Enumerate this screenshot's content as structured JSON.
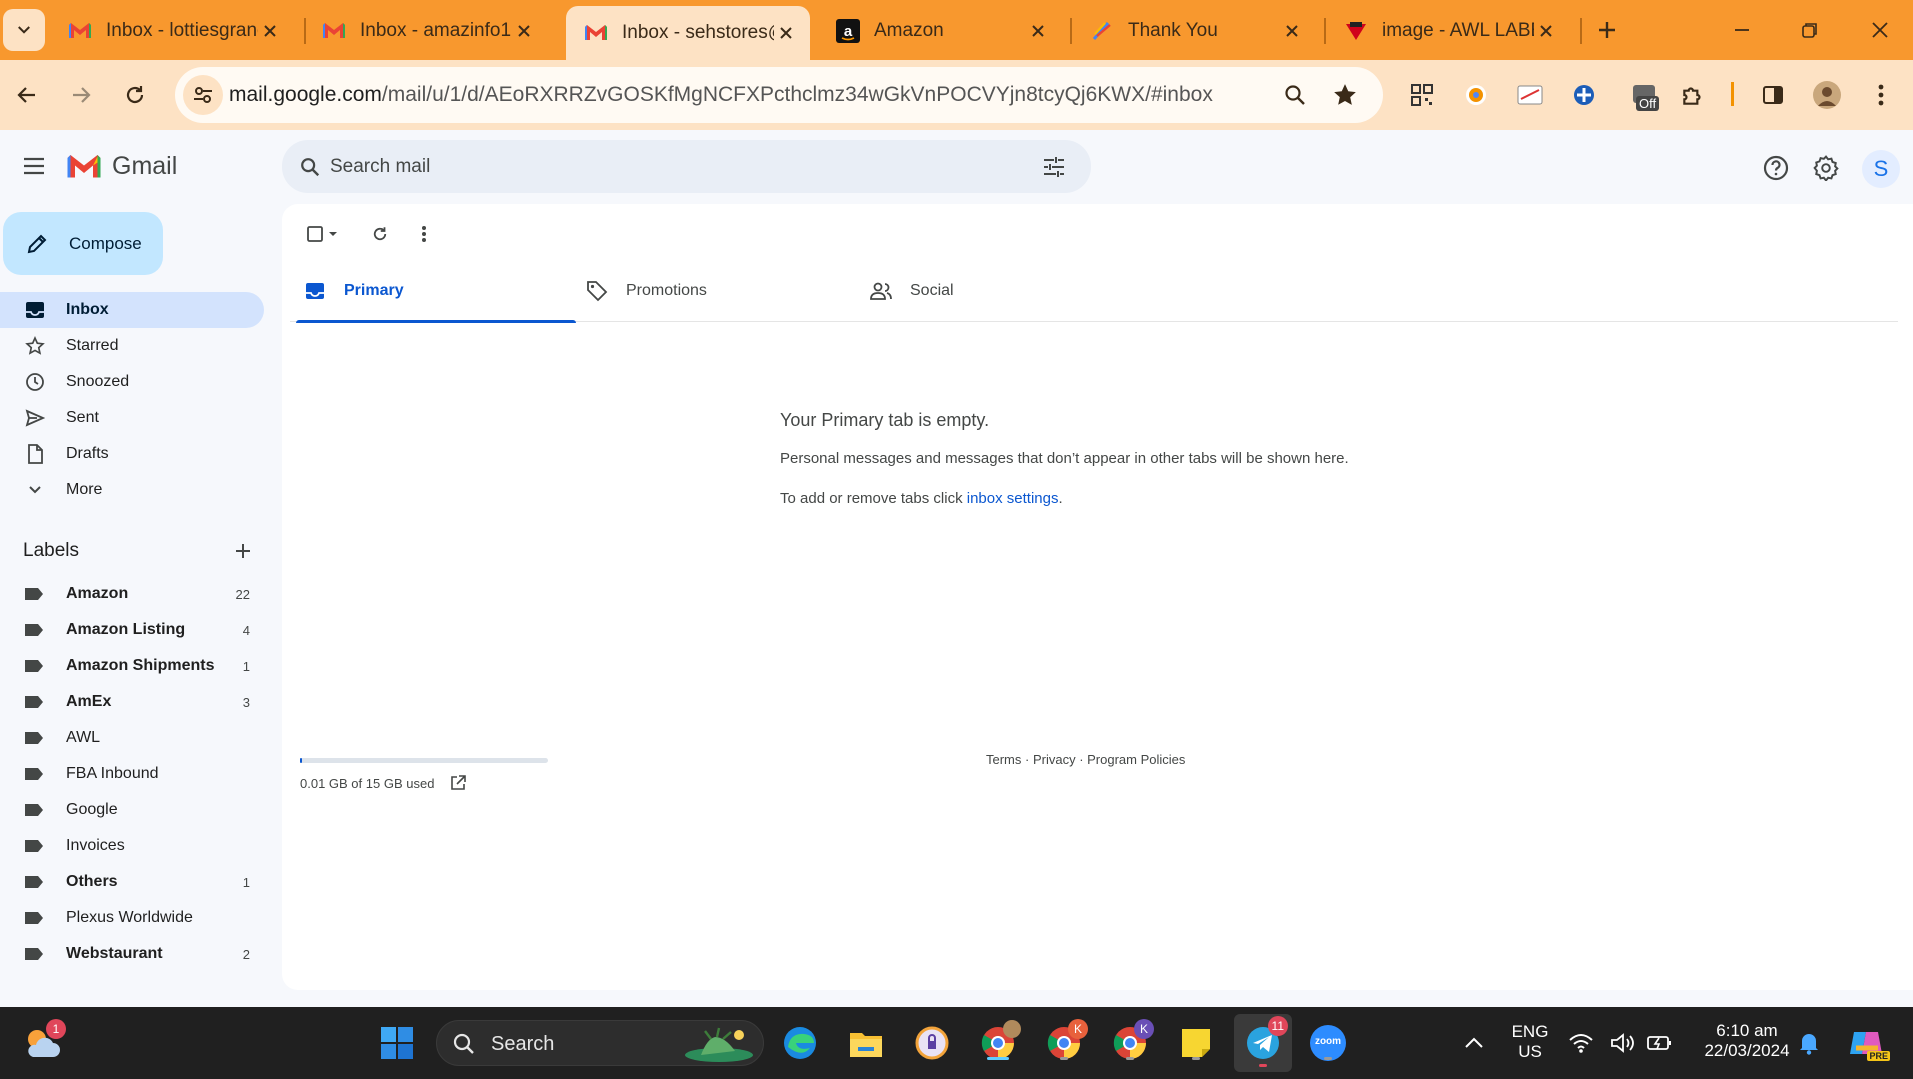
{
  "browser": {
    "tabs": [
      {
        "title": "Inbox - lottiesgrand",
        "icon": "gmail-icon"
      },
      {
        "title": "Inbox - amazinfo1",
        "icon": "gmail-icon"
      },
      {
        "title": "Inbox - sehstores@",
        "icon": "gmail-icon",
        "active": true
      },
      {
        "title": "Amazon",
        "icon": "amazon-icon"
      },
      {
        "title": "Thank You",
        "icon": "feather-icon"
      },
      {
        "title": "image - AWL LABEL",
        "icon": "awl-icon"
      }
    ],
    "url_host": "mail.google.com",
    "url_path": "/mail/u/1/d/AEoRXRRZvGOSKfMgNCFXPcthclmz34wGkVnPOCVYjn8tcyQj6KWX/#inbox",
    "extension_badge": "Off",
    "theme_color": "#f8982e"
  },
  "gmail": {
    "logo_text": "Gmail",
    "search_placeholder": "Search mail",
    "avatar_letter": "S",
    "compose_label": "Compose",
    "nav": [
      {
        "label": "Inbox",
        "icon": "inbox-icon",
        "active": true
      },
      {
        "label": "Starred",
        "icon": "star-icon"
      },
      {
        "label": "Snoozed",
        "icon": "clock-icon"
      },
      {
        "label": "Sent",
        "icon": "send-icon"
      },
      {
        "label": "Drafts",
        "icon": "draft-icon"
      },
      {
        "label": "More",
        "icon": "chevron-down-icon"
      }
    ],
    "labels_title": "Labels",
    "labels": [
      {
        "name": "Amazon",
        "count": "22"
      },
      {
        "name": "Amazon Listing",
        "count": "4"
      },
      {
        "name": "Amazon Shipments",
        "count": "1"
      },
      {
        "name": "AmEx",
        "count": "3"
      },
      {
        "name": "AWL",
        "count": ""
      },
      {
        "name": "FBA Inbound",
        "count": ""
      },
      {
        "name": "Google",
        "count": ""
      },
      {
        "name": "Invoices",
        "count": ""
      },
      {
        "name": "Others",
        "count": "1"
      },
      {
        "name": "Plexus Worldwide",
        "count": ""
      },
      {
        "name": "Webstaurant",
        "count": "2"
      }
    ],
    "categories": [
      {
        "label": "Primary",
        "icon": "inbox-tab-icon",
        "active": true
      },
      {
        "label": "Promotions",
        "icon": "tag-icon"
      },
      {
        "label": "Social",
        "icon": "people-icon"
      }
    ],
    "empty": {
      "title": "Your Primary tab is empty.",
      "description": "Personal messages and messages that don’t appear in other tabs will be shown here.",
      "hint_prefix": "To add or remove tabs click ",
      "hint_link": "inbox settings",
      "hint_suffix": "."
    },
    "storage": {
      "text": "0.01 GB of 15 GB used",
      "fraction": 0.001
    },
    "footer": {
      "terms": "Terms",
      "privacy": "Privacy",
      "policies": "Program Policies",
      "sep": " · "
    }
  },
  "taskbar": {
    "search_label": "Search",
    "weather_badge": "1",
    "chrome_k_badge": "K",
    "chrome_k2_badge": "K",
    "telegram_badge": "11",
    "zoom_label": "zoom",
    "lang_1": "ENG",
    "lang_2": "US",
    "time": "6:10 am",
    "date": "22/03/2024",
    "copilot_badge": "PRE"
  }
}
